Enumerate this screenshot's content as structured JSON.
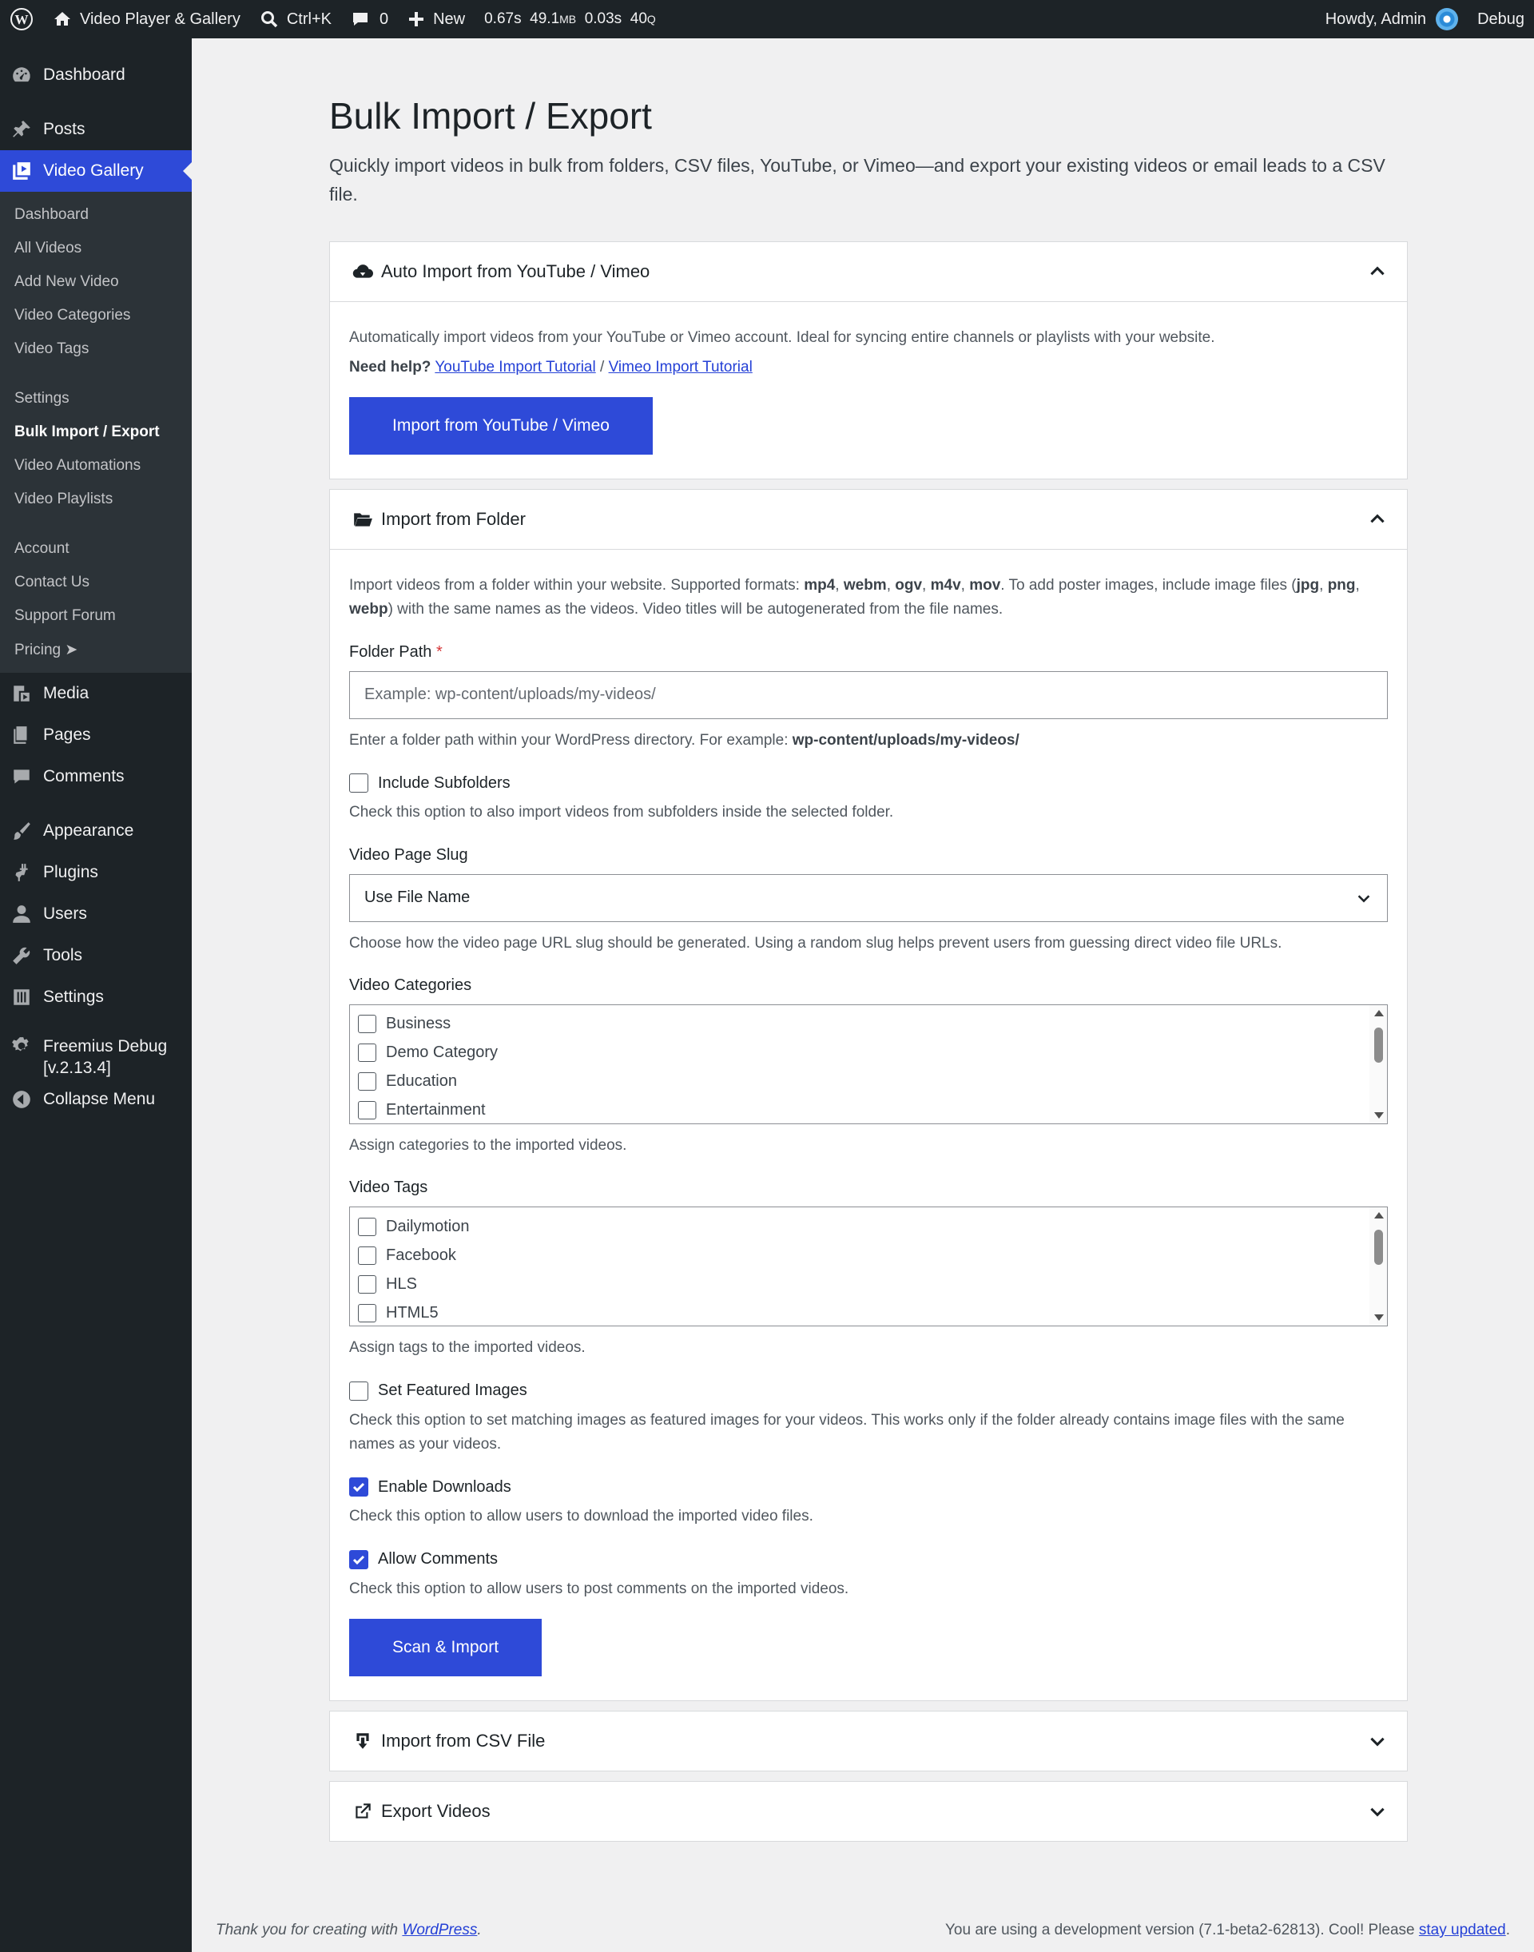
{
  "adminbar": {
    "site_name": "Video Player & Gallery",
    "search_shortcut": "Ctrl+K",
    "comments_count": "0",
    "new_label": "New",
    "perf_time": "0.67s",
    "perf_mem": "49.1",
    "perf_mem_unit": "MB",
    "perf_query_time": "0.03s",
    "perf_queries": "40",
    "perf_queries_unit": "Q",
    "howdy": "Howdy, Admin",
    "debug": "Debug"
  },
  "sidebar": {
    "dashboard": "Dashboard",
    "posts": "Posts",
    "video_gallery": "Video Gallery",
    "submenu": {
      "group1": [
        "Dashboard",
        "All Videos",
        "Add New Video",
        "Video Categories",
        "Video Tags"
      ],
      "group2": [
        "Settings",
        "Bulk Import / Export",
        "Video Automations",
        "Video Playlists"
      ],
      "group3": [
        "Account",
        "Contact Us",
        "Support Forum",
        "Pricing ➤"
      ]
    },
    "media": "Media",
    "pages": "Pages",
    "comments": "Comments",
    "appearance": "Appearance",
    "plugins": "Plugins",
    "users": "Users",
    "tools": "Tools",
    "settings": "Settings",
    "freemius": "Freemius Debug [v.2.13.4]",
    "collapse": "Collapse Menu"
  },
  "page": {
    "title": "Bulk Import / Export",
    "description": "Quickly import videos in bulk from folders, CSV files, YouTube, or Vimeo—and export your existing videos or email leads to a CSV file."
  },
  "auto_import": {
    "title": "Auto Import from YouTube / Vimeo",
    "description": "Automatically import videos from your YouTube or Vimeo account. Ideal for syncing entire channels or playlists with your website.",
    "need_help": "Need help?",
    "youtube_link": "YouTube Import Tutorial",
    "separator": "/",
    "vimeo_link": "Vimeo Import Tutorial",
    "button": "Import from YouTube / Vimeo"
  },
  "folder_import": {
    "title": "Import from Folder",
    "desc_pre": "Import videos from a folder within your website. Supported formats: ",
    "formats": [
      "mp4",
      "webm",
      "ogv",
      "m4v",
      "mov"
    ],
    "desc_mid": ". To add poster images, include image files (",
    "image_formats": [
      "jpg",
      "png",
      "webp"
    ],
    "desc_post": ") with the same names as the videos. Video titles will be autogenerated from the file names.",
    "folder_path_label": "Folder Path",
    "required_mark": "*",
    "folder_path_placeholder": "Example: wp-content/uploads/my-videos/",
    "folder_path_help": "Enter a folder path within your WordPress directory. For example: ",
    "folder_path_example": "wp-content/uploads/my-videos/",
    "include_subfolders_label": "Include Subfolders",
    "include_subfolders_checked": false,
    "include_subfolders_help": "Check this option to also import videos from subfolders inside the selected folder.",
    "slug_label": "Video Page Slug",
    "slug_value": "Use File Name",
    "slug_help": "Choose how the video page URL slug should be generated. Using a random slug helps prevent users from guessing direct video file URLs.",
    "categories_label": "Video Categories",
    "categories": [
      "Business",
      "Demo Category",
      "Education",
      "Entertainment"
    ],
    "categories_help": "Assign categories to the imported videos.",
    "tags_label": "Video Tags",
    "tags": [
      "Dailymotion",
      "Facebook",
      "HLS",
      "HTML5"
    ],
    "tags_help": "Assign tags to the imported videos.",
    "featured_label": "Set Featured Images",
    "featured_checked": false,
    "featured_help": "Check this option to set matching images as featured images for your videos. This works only if the folder already contains image files with the same names as your videos.",
    "downloads_label": "Enable Downloads",
    "downloads_checked": true,
    "downloads_help": "Check this option to allow users to download the imported video files.",
    "comments_label": "Allow Comments",
    "comments_checked": true,
    "comments_help": "Check this option to allow users to post comments on the imported videos.",
    "button": "Scan & Import"
  },
  "csv_import": {
    "title": "Import from CSV File"
  },
  "export": {
    "title": "Export Videos"
  },
  "footer": {
    "thanks_pre": "Thank you for creating with ",
    "thanks_link": "WordPress",
    "thanks_post": ".",
    "version_pre": "You are using a development version (7.1-beta2-62813). Cool! Please ",
    "version_link": "stay updated",
    "version_post": "."
  },
  "colors": {
    "accent": "#2e4ad8",
    "adminbar_bg": "#1d2327",
    "page_bg": "#f0f0f1"
  }
}
